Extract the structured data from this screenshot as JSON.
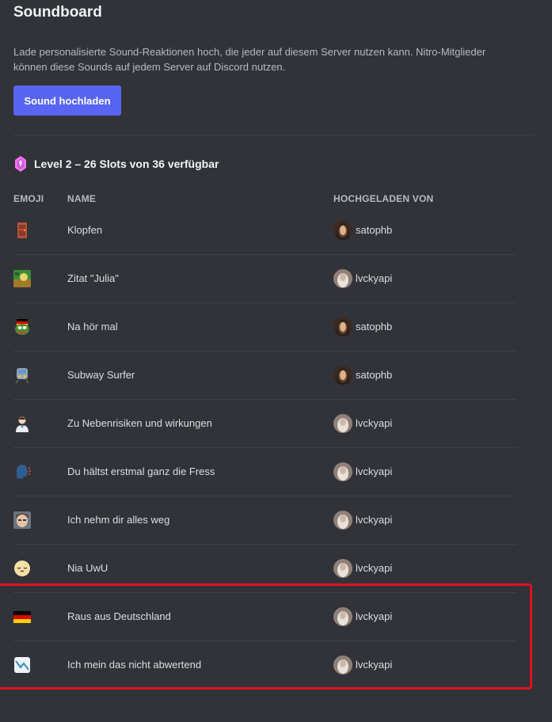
{
  "page": {
    "title": "Soundboard",
    "description": "Lade personalisierte Sound-Reaktionen hoch, die jeder auf diesem Server nutzen kann. Nitro-Mitglieder können diese Sounds auf jedem Server auf Discord nutzen.",
    "upload_button": "Sound hochladen",
    "level_text": "Level 2 – 26 Slots von 36 verfügbar"
  },
  "table": {
    "columns": [
      "EMOJI",
      "NAME",
      "HOCHGELADEN VON"
    ],
    "rows": [
      {
        "emoji": "door-emoji",
        "name": "Klopfen",
        "uploader": "satophb"
      },
      {
        "emoji": "custom-image-emoji",
        "name": "Zitat \"Julia\"",
        "uploader": "lvckyapi"
      },
      {
        "emoji": "pepe-germany-emoji",
        "name": "Na hör mal",
        "uploader": "satophb"
      },
      {
        "emoji": "train-emoji",
        "name": "Subway Surfer",
        "uploader": "satophb"
      },
      {
        "emoji": "health-worker-emoji",
        "name": "Zu Nebenrisiken und wirkungen",
        "uploader": "lvckyapi"
      },
      {
        "emoji": "speaking-head-emoji",
        "name": "Du hältst erstmal ganz die Fress",
        "uploader": "lvckyapi"
      },
      {
        "emoji": "face-photo-emoji",
        "name": "Ich nehm dir alles weg",
        "uploader": "lvckyapi"
      },
      {
        "emoji": "uwu-face-emoji",
        "name": "Nia UwU",
        "uploader": "lvckyapi"
      },
      {
        "emoji": "germany-flag-emoji",
        "name": "Raus aus Deutschland",
        "uploader": "lvckyapi"
      },
      {
        "emoji": "chart-down-emoji",
        "name": "Ich mein das nicht abwertend",
        "uploader": "lvckyapi"
      }
    ]
  },
  "colors": {
    "background": "#313338",
    "accent": "#5865f2",
    "highlight": "#e0101c"
  }
}
